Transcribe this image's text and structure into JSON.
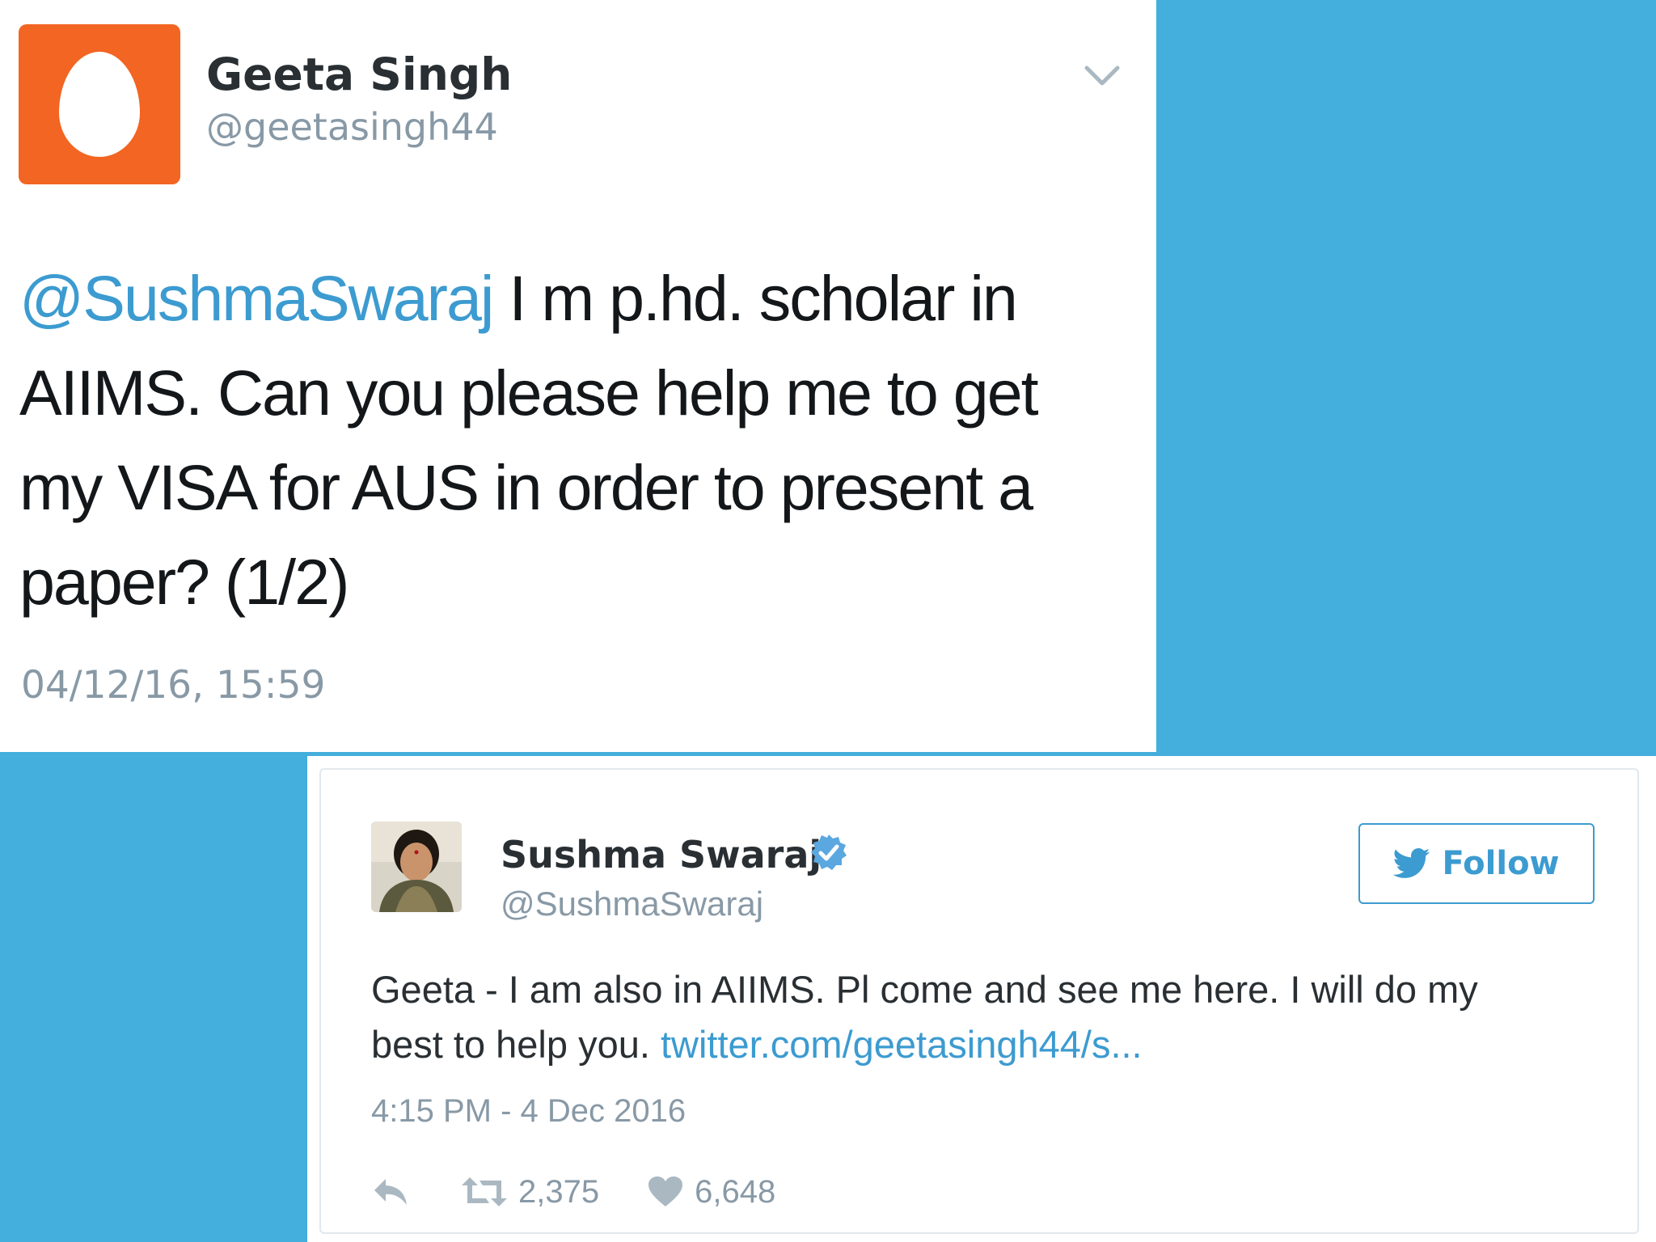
{
  "colors": {
    "background": "#44aedc",
    "egg_avatar": "#f26522",
    "link": "#3c9bd0",
    "verified": "#5ba7e0"
  },
  "tweet1": {
    "avatar_icon": "default-egg-avatar-icon",
    "name": "Geeta Singh",
    "handle": "@geetasingh44",
    "menu_icon": "chevron-down-icon",
    "text": {
      "mention": "@SushmaSwaraj",
      "line1_rest": " I m p.hd. scholar in",
      "line2": "AIIMS. Can you please help me to get",
      "line3": "my VISA for AUS in order to present a",
      "line4": "paper? (1/2)"
    },
    "timestamp": "04/12/16, 15:59"
  },
  "tweet2": {
    "avatar_icon": "profile-photo",
    "name": "Sushma Swaraj",
    "verified_icon": "verified-badge-icon",
    "handle": "@SushmaSwaraj",
    "follow": {
      "icon": "twitter-bird-icon",
      "label": "Follow"
    },
    "text": {
      "line1": "Geeta - I am also in AIIMS. Pl come and see me here. I will do my",
      "line2_prefix": "best to help you. ",
      "link": "twitter.com/geetasingh44/s..."
    },
    "timestamp": "4:15 PM - 4 Dec 2016",
    "actions": {
      "reply_icon": "reply-icon",
      "retweet_icon": "retweet-icon",
      "retweets": "2,375",
      "like_icon": "heart-icon",
      "likes": "6,648"
    }
  }
}
